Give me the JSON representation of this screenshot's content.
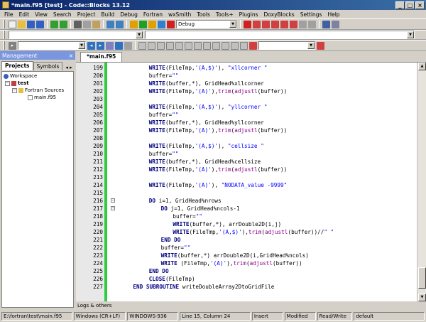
{
  "window": {
    "title": "*main.f95 [test] - Code::Blocks 13.12",
    "minimize_glyph": "_",
    "maximize_glyph": "□",
    "close_glyph": "×"
  },
  "menu": [
    "File",
    "Edit",
    "View",
    "Search",
    "Project",
    "Build",
    "Debug",
    "Fortran",
    "wxSmith",
    "Tools",
    "Tools+",
    "Plugins",
    "DoxyBlocks",
    "Settings",
    "Help"
  ],
  "toolbar": {
    "build_target": "Debug"
  },
  "management": {
    "title": "Management",
    "tabs": [
      "Projects",
      "Symbols"
    ],
    "tree": {
      "workspace": "Workspace",
      "project": "test",
      "folder": "Fortran Sources",
      "file": "main.f95"
    }
  },
  "editor": {
    "tab_label": "*main.f95",
    "lines": [
      {
        "n": "199",
        "indent": 8,
        "tokens": [
          [
            "kw",
            "WRITE"
          ],
          [
            "id",
            "(FileTmp,"
          ],
          [
            "str",
            "'(A,$)'"
          ],
          [
            "id",
            "), "
          ],
          [
            "str",
            "\"xllcorner \""
          ]
        ]
      },
      {
        "n": "200",
        "indent": 8,
        "tokens": [
          [
            "id",
            "buffer="
          ],
          [
            "str",
            "\"\""
          ]
        ]
      },
      {
        "n": "201",
        "indent": 8,
        "tokens": [
          [
            "kw",
            "WRITE"
          ],
          [
            "id",
            "(buffer,*), GridHead%xllcorner"
          ]
        ]
      },
      {
        "n": "202",
        "indent": 8,
        "tokens": [
          [
            "kw",
            "WRITE"
          ],
          [
            "id",
            "(FileTmp,"
          ],
          [
            "str",
            "'(A)'"
          ],
          [
            "id",
            "),"
          ],
          [
            "fn",
            "trim"
          ],
          [
            "id",
            "("
          ],
          [
            "fn",
            "adjustl"
          ],
          [
            "id",
            "(buffer))"
          ]
        ]
      },
      {
        "n": "203",
        "indent": 8,
        "tokens": []
      },
      {
        "n": "204",
        "indent": 8,
        "tokens": [
          [
            "kw",
            "WRITE"
          ],
          [
            "id",
            "(FileTmp,"
          ],
          [
            "str",
            "'(A,$)'"
          ],
          [
            "id",
            "), "
          ],
          [
            "str",
            "\"yllcorner \""
          ]
        ]
      },
      {
        "n": "205",
        "indent": 8,
        "tokens": [
          [
            "id",
            "buffer="
          ],
          [
            "str",
            "\"\""
          ]
        ]
      },
      {
        "n": "206",
        "indent": 8,
        "tokens": [
          [
            "kw",
            "WRITE"
          ],
          [
            "id",
            "(buffer,*), GridHead%yllcorner"
          ]
        ]
      },
      {
        "n": "207",
        "indent": 8,
        "tokens": [
          [
            "kw",
            "WRITE"
          ],
          [
            "id",
            "(FileTmp,"
          ],
          [
            "str",
            "'(A)'"
          ],
          [
            "id",
            "),"
          ],
          [
            "fn",
            "trim"
          ],
          [
            "id",
            "("
          ],
          [
            "fn",
            "adjustl"
          ],
          [
            "id",
            "(buffer))"
          ]
        ]
      },
      {
        "n": "208",
        "indent": 8,
        "tokens": []
      },
      {
        "n": "209",
        "indent": 8,
        "tokens": [
          [
            "kw",
            "WRITE"
          ],
          [
            "id",
            "(FileTmp,"
          ],
          [
            "str",
            "'(A,$)'"
          ],
          [
            "id",
            "), "
          ],
          [
            "str",
            "\"cellsize \""
          ]
        ]
      },
      {
        "n": "210",
        "indent": 8,
        "tokens": [
          [
            "id",
            "buffer="
          ],
          [
            "str",
            "\"\""
          ]
        ]
      },
      {
        "n": "211",
        "indent": 8,
        "tokens": [
          [
            "kw",
            "WRITE"
          ],
          [
            "id",
            "(buffer,*), GridHead%cellsize"
          ]
        ]
      },
      {
        "n": "212",
        "indent": 8,
        "tokens": [
          [
            "kw",
            "WRITE"
          ],
          [
            "id",
            "(FileTmp,"
          ],
          [
            "str",
            "'(A)'"
          ],
          [
            "id",
            "),"
          ],
          [
            "fn",
            "trim"
          ],
          [
            "id",
            "("
          ],
          [
            "fn",
            "adjustl"
          ],
          [
            "id",
            "(buffer))"
          ]
        ]
      },
      {
        "n": "213",
        "indent": 8,
        "tokens": []
      },
      {
        "n": "214",
        "indent": 8,
        "tokens": [
          [
            "kw",
            "WRITE"
          ],
          [
            "id",
            "(FileTmp,"
          ],
          [
            "str",
            "'(A)'"
          ],
          [
            "id",
            "), "
          ],
          [
            "str",
            "\"NODATA_value -9999\""
          ]
        ]
      },
      {
        "n": "215",
        "indent": 8,
        "tokens": []
      },
      {
        "n": "216",
        "indent": 8,
        "tokens": [
          [
            "kw",
            "DO"
          ],
          [
            "id",
            " i=1, GridHead%nrows"
          ]
        ]
      },
      {
        "n": "217",
        "indent": 11,
        "tokens": [
          [
            "kw",
            "DO"
          ],
          [
            "id",
            " j=1, GridHead%ncols-1"
          ]
        ]
      },
      {
        "n": "218",
        "indent": 14,
        "tokens": [
          [
            "id",
            "buffer="
          ],
          [
            "str",
            "\"\""
          ]
        ]
      },
      {
        "n": "219",
        "indent": 14,
        "tokens": [
          [
            "kw",
            "WRITE"
          ],
          [
            "id",
            "(buffer,*), arrDouble2D(i,j)"
          ]
        ]
      },
      {
        "n": "220",
        "indent": 14,
        "tokens": [
          [
            "kw",
            "WRITE"
          ],
          [
            "id",
            "(FileTmp,"
          ],
          [
            "str",
            "'(A,$)'"
          ],
          [
            "id",
            "),"
          ],
          [
            "fn",
            "trim"
          ],
          [
            "id",
            "("
          ],
          [
            "fn",
            "adjustl"
          ],
          [
            "id",
            "(buffer))//"
          ],
          [
            "str",
            "\" \""
          ]
        ]
      },
      {
        "n": "221",
        "indent": 11,
        "tokens": [
          [
            "kw",
            "END DO"
          ]
        ]
      },
      {
        "n": "222",
        "indent": 11,
        "tokens": [
          [
            "id",
            "buffer="
          ],
          [
            "str",
            "\"\""
          ]
        ]
      },
      {
        "n": "223",
        "indent": 11,
        "tokens": [
          [
            "kw",
            "WRITE"
          ],
          [
            "id",
            "(buffer,*) arrDouble2D(i,GridHead%ncols)"
          ]
        ]
      },
      {
        "n": "224",
        "indent": 11,
        "tokens": [
          [
            "kw",
            "WRITE"
          ],
          [
            "id",
            " (FileTmp,"
          ],
          [
            "str",
            "'(A)'"
          ],
          [
            "id",
            "),"
          ],
          [
            "fn",
            "trim"
          ],
          [
            "id",
            "("
          ],
          [
            "fn",
            "adjustl"
          ],
          [
            "id",
            "(buffer))"
          ]
        ]
      },
      {
        "n": "225",
        "indent": 8,
        "tokens": [
          [
            "kw",
            "END DO"
          ]
        ]
      },
      {
        "n": "226",
        "indent": 8,
        "tokens": [
          [
            "kw",
            "CLOSE"
          ],
          [
            "id",
            "(FileTmp)"
          ]
        ]
      },
      {
        "n": "227",
        "indent": 4,
        "tokens": [
          [
            "kw",
            "END SUBROUTINE"
          ],
          [
            "id",
            " writeDoubleArray2DtoGridFile"
          ]
        ]
      }
    ]
  },
  "logs": {
    "label": "Logs & others"
  },
  "statusbar": {
    "path": "E:\\fortran\\test\\main.f95",
    "eol": "Windows (CR+LF)",
    "encoding": "WINDOWS-936",
    "position": "Line 15, Column 24",
    "insert": "Insert",
    "modified": "Modified",
    "rw": "Read/Write",
    "mode": "default"
  }
}
